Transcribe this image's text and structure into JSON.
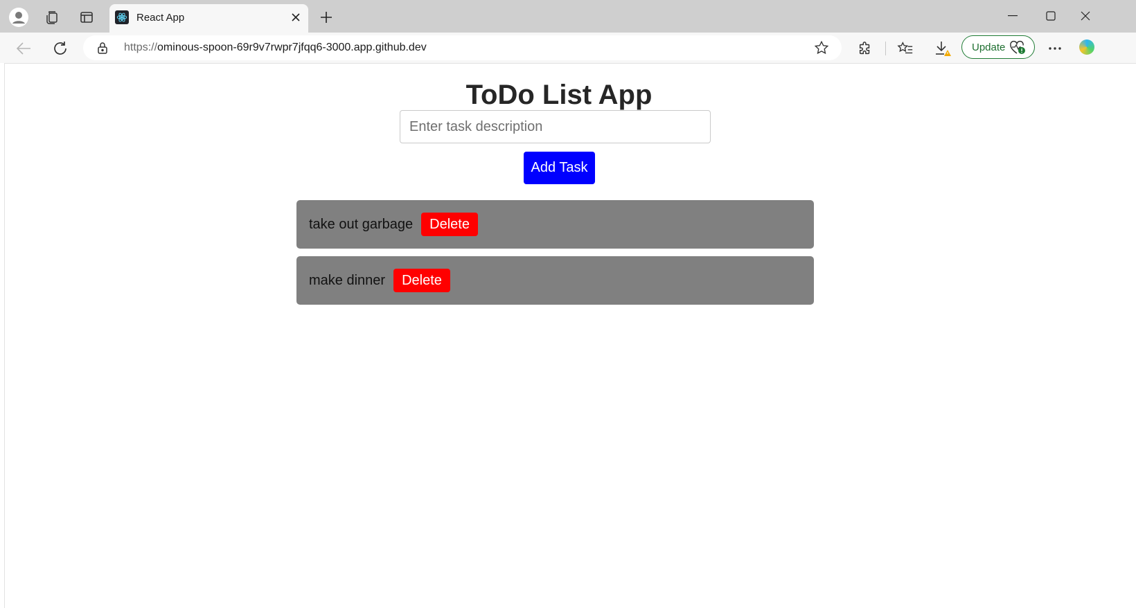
{
  "browser": {
    "tab": {
      "title": "React App",
      "favicon": "react-logo-icon"
    },
    "address_bar": {
      "scheme": "https://",
      "host": "ominous-spoon-69r9v7rwpr7jfqq6-3000.app.github.dev"
    },
    "update_button": {
      "label": "Update",
      "accent": "#1e7b34"
    }
  },
  "app": {
    "title": "ToDo List App",
    "input": {
      "placeholder": "Enter task description",
      "value": ""
    },
    "add_button": {
      "label": "Add Task",
      "color": "#0000ff"
    },
    "tasks": [
      {
        "text": "take out garbage",
        "delete_label": "Delete"
      },
      {
        "text": "make dinner",
        "delete_label": "Delete"
      }
    ],
    "colors": {
      "task_bg": "#808080",
      "delete_bg": "#ff0000"
    }
  }
}
